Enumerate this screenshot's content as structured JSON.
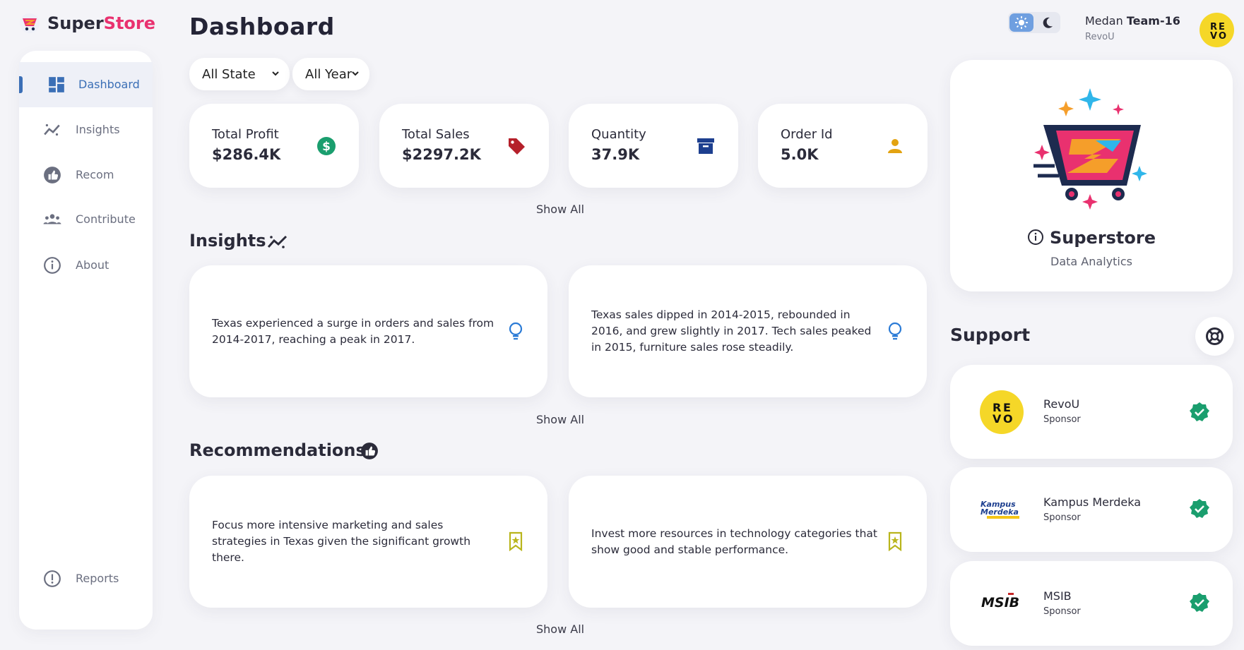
{
  "app": {
    "name_part1": "Super",
    "name_part2": "Store"
  },
  "colors": {
    "accent": "#3b6fb6",
    "brand_pink": "#e9316f",
    "background": "#f4f4f8",
    "check_green": "#1a9e6e"
  },
  "sidebar": {
    "items": [
      {
        "label": "Dashboard",
        "icon": "dashboard-icon",
        "active": true
      },
      {
        "label": "Insights",
        "icon": "trend-icon"
      },
      {
        "label": "Recom",
        "icon": "thumbs-up-icon"
      },
      {
        "label": "Contribute",
        "icon": "people-icon"
      },
      {
        "label": "About",
        "icon": "info-icon"
      }
    ],
    "footer_item": {
      "label": "Reports",
      "icon": "alert-icon"
    }
  },
  "header": {
    "title": "Dashboard",
    "filters": {
      "state": "All State",
      "year": "All Year"
    },
    "user": {
      "first": "Medan ",
      "team": "Team-16",
      "org": "RevoU"
    }
  },
  "stats": [
    {
      "label": "Total Profit",
      "value": "$286.4K",
      "icon": "dollar-icon",
      "color": "#1a9e6e"
    },
    {
      "label": "Total Sales",
      "value": "$2297.2K",
      "icon": "tag-icon",
      "color": "#b5202a"
    },
    {
      "label": "Quantity",
      "value": "37.9K",
      "icon": "archive-box-icon",
      "color": "#1d3f8f"
    },
    {
      "label": "Order Id",
      "value": "5.0K",
      "icon": "user-icon",
      "color": "#e3a311"
    }
  ],
  "show_all": "Show All",
  "insights": {
    "title": "Insights",
    "cards": [
      {
        "text": "Texas experienced a surge in orders and sales from 2014-2017, reaching a peak in 2017."
      },
      {
        "text": "Texas sales dipped in 2014-2015, rebounded in 2016, and grew slightly in 2017. Tech sales peaked in 2015, furniture sales rose steadily."
      }
    ]
  },
  "recommendations": {
    "title": "Recommendations",
    "cards": [
      {
        "text": "Focus more intensive marketing and sales strategies in Texas given the significant growth there."
      },
      {
        "text": "Invest more resources in technology categories that show good and stable performance."
      }
    ]
  },
  "promo": {
    "title": "Superstore",
    "subtitle": "Data Analytics"
  },
  "support": {
    "title": "Support",
    "sponsors": [
      {
        "name": "RevoU",
        "role": "Sponsor",
        "logo_text": "REVO"
      },
      {
        "name": "Kampus Merdeka",
        "role": "Sponsor",
        "logo_text": "Kampus Merdeka"
      },
      {
        "name": "MSIB",
        "role": "Sponsor",
        "logo_text": "MSIB"
      }
    ]
  }
}
